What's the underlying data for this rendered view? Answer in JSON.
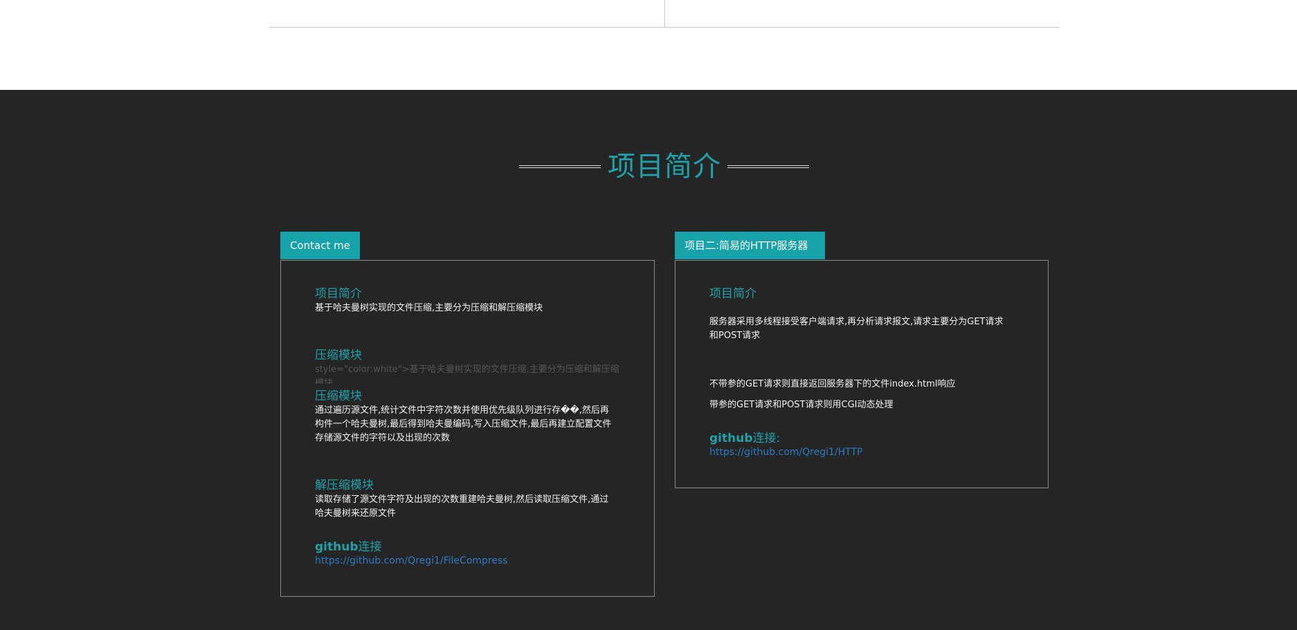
{
  "heading": "项目简介",
  "left_card": {
    "tab_label": "Contact me",
    "intro_title": "项目简介",
    "intro_text": "基于哈夫曼树实现的文件压缩,主要分为压缩和解压缩模块",
    "compress_title_1": "压缩模块",
    "ghost_text": "style=\"color:white\">基于哈夫曼树实现的文件压缩,主要分为压缩和解压缩模块",
    "compress_title_2": "压缩模块",
    "compress_text": "通过遍历源文件,统计文件中字符次数并使用优先级队列进行存��,然后再构件一个哈夫曼树,最后得到哈夫曼编码,写入压缩文件,最后再建立配置文件存储源文件的字符以及出现的次数",
    "decompress_title": "解压缩模块",
    "decompress_text": "读取存储了源文件字符及出现的次数重建哈夫曼树,然后读取压缩文件,通过哈夫曼树来还原文件",
    "github_bold": "github",
    "github_rest": "连接",
    "github_url": "https://github.com/Qregi1/FileCompress"
  },
  "right_card": {
    "tab_label": "项目二:简易的HTTP服务器",
    "intro_title": "项目简介",
    "intro_text": "服务器采用多线程接受客户端请求,再分析请求报文,请求主要分为GET请求和POST请求",
    "line_1": "不带参的GET请求则直接返回服务器下的文件index.html响应",
    "line_2": "带参的GET请求和POST请求则用CGI动态处理",
    "github_bold": "github",
    "github_rest": "连接:",
    "github_url": "https://github.com/Qregi1/HTTP"
  }
}
